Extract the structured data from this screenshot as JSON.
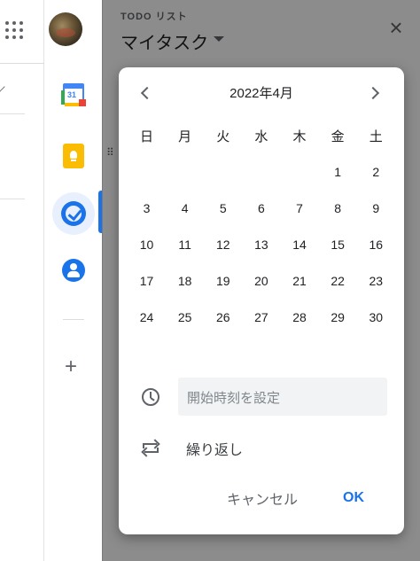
{
  "panel": {
    "subtitle": "TODO リスト",
    "title": "マイタスク"
  },
  "rail": {
    "calendar_icon_day": "31"
  },
  "datepicker": {
    "month_label": "2022年4月",
    "weekdays": [
      "日",
      "月",
      "火",
      "水",
      "木",
      "金",
      "土"
    ],
    "first_weekday_index": 5,
    "days": [
      "1",
      "2",
      "3",
      "4",
      "5",
      "6",
      "7",
      "8",
      "9",
      "10",
      "11",
      "12",
      "13",
      "14",
      "15",
      "16",
      "17",
      "18",
      "19",
      "20",
      "21",
      "22",
      "23",
      "24",
      "25",
      "26",
      "27",
      "28",
      "29",
      "30"
    ],
    "time_placeholder": "開始時刻を設定",
    "repeat_label": "繰り返し",
    "cancel_label": "キャンセル",
    "ok_label": "OK"
  },
  "colors": {
    "accent": "#1a73e8",
    "scrim": "rgba(0,0,0,0.45)"
  },
  "icons": [
    "apps-grid-icon",
    "avatar",
    "calendar-icon",
    "keep-icon",
    "tasks-icon",
    "contacts-icon",
    "add-icon",
    "drag-handle-icon",
    "close-icon",
    "chevron-left-icon",
    "chevron-right-icon",
    "clock-icon",
    "repeat-icon",
    "dropdown-caret-icon"
  ]
}
